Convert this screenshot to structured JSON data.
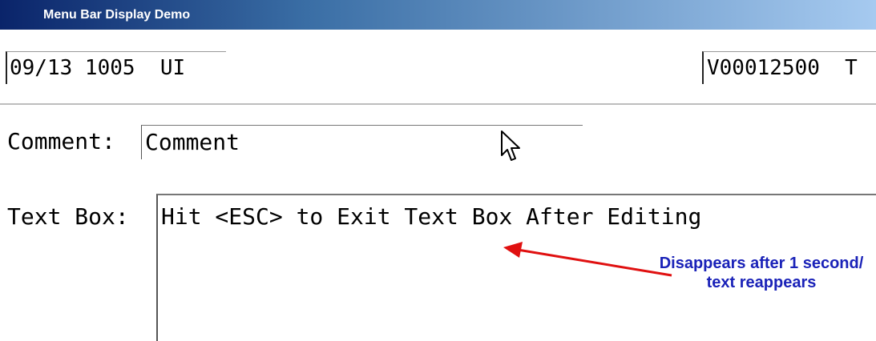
{
  "window": {
    "title": "Menu Bar Display Demo"
  },
  "statusbar": {
    "left_text": "09/13 1005  UI",
    "right_text": "V00012500  T"
  },
  "form": {
    "comment_label": "Comment:",
    "comment_value": "Comment",
    "textbox_label": "Text Box:",
    "textbox_value": "Hit <ESC> to Exit Text Box After Editing"
  },
  "annotation": {
    "text": "Disappears after 1 second/ text reappears",
    "color": "#1a22b8",
    "arrow_color": "#e01010"
  },
  "icons": {
    "cursor": "mouse-pointer-icon",
    "arrow": "arrow-left-icon"
  }
}
